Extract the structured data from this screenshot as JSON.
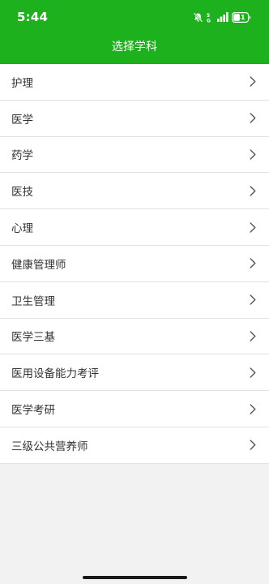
{
  "status": {
    "time": "5:44",
    "battery": "41"
  },
  "header": {
    "title": "选择学科"
  },
  "subjects": [
    {
      "label": "护理"
    },
    {
      "label": "医学"
    },
    {
      "label": "药学"
    },
    {
      "label": "医技"
    },
    {
      "label": "心理"
    },
    {
      "label": "健康管理师"
    },
    {
      "label": "卫生管理"
    },
    {
      "label": "医学三基"
    },
    {
      "label": "医用设备能力考评"
    },
    {
      "label": "医学考研"
    },
    {
      "label": "三级公共营养师"
    }
  ],
  "icons": {
    "row_arrow": "chevron-right-icon",
    "status": [
      "bell-muted-icon",
      "5g-icon",
      "signal-icon",
      "battery-icon"
    ]
  },
  "colors": {
    "header_bg": "#1db11d",
    "page_bg": "#f2f2f2"
  }
}
